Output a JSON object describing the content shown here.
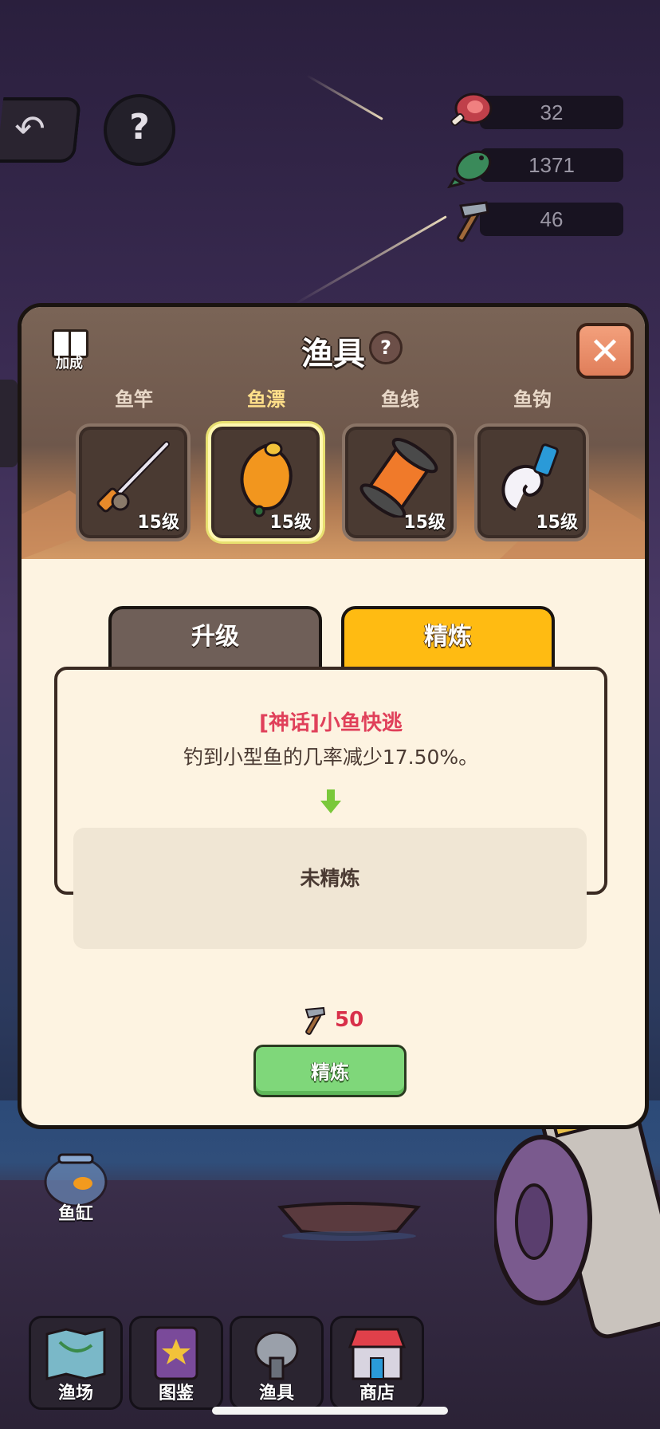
{
  "resources": [
    {
      "name": "meat-icon",
      "value": "32"
    },
    {
      "name": "fish-icon",
      "value": "1371"
    },
    {
      "name": "hammer-icon",
      "value": "46"
    }
  ],
  "top": {
    "back_icon": "back-arrow-icon",
    "help_label": "?"
  },
  "panel": {
    "title": "渔具",
    "title_help": "?",
    "bonus_label": "加成",
    "close_label": "✕",
    "slots": [
      {
        "label": "鱼竿",
        "level": "15级",
        "icon": "fishing-rod-icon",
        "active": false
      },
      {
        "label": "鱼漂",
        "level": "15级",
        "icon": "float-icon",
        "active": true
      },
      {
        "label": "鱼线",
        "level": "15级",
        "icon": "line-spool-icon",
        "active": false
      },
      {
        "label": "鱼钩",
        "level": "15级",
        "icon": "hook-shell-icon",
        "active": false
      }
    ],
    "tabs": {
      "upgrade": "升级",
      "refine": "精炼"
    },
    "skill_name": "[神话]小鱼快逃",
    "skill_desc": "钓到小型鱼的几率减少17.50%。",
    "refine_status": "未精炼",
    "cost_value": "50",
    "refine_button": "精炼"
  },
  "fishbowl_label": "鱼缸",
  "nav": [
    {
      "label": "渔场",
      "icon": "map-icon"
    },
    {
      "label": "图鉴",
      "icon": "book-icon"
    },
    {
      "label": "渔具",
      "icon": "gear-reel-icon"
    },
    {
      "label": "商店",
      "icon": "shop-icon"
    }
  ],
  "colors": {
    "accent_yellow": "#ffbb12",
    "skill_red": "#e0405a",
    "button_green": "#7fd77a",
    "panel_bg": "#fdf3e1"
  }
}
